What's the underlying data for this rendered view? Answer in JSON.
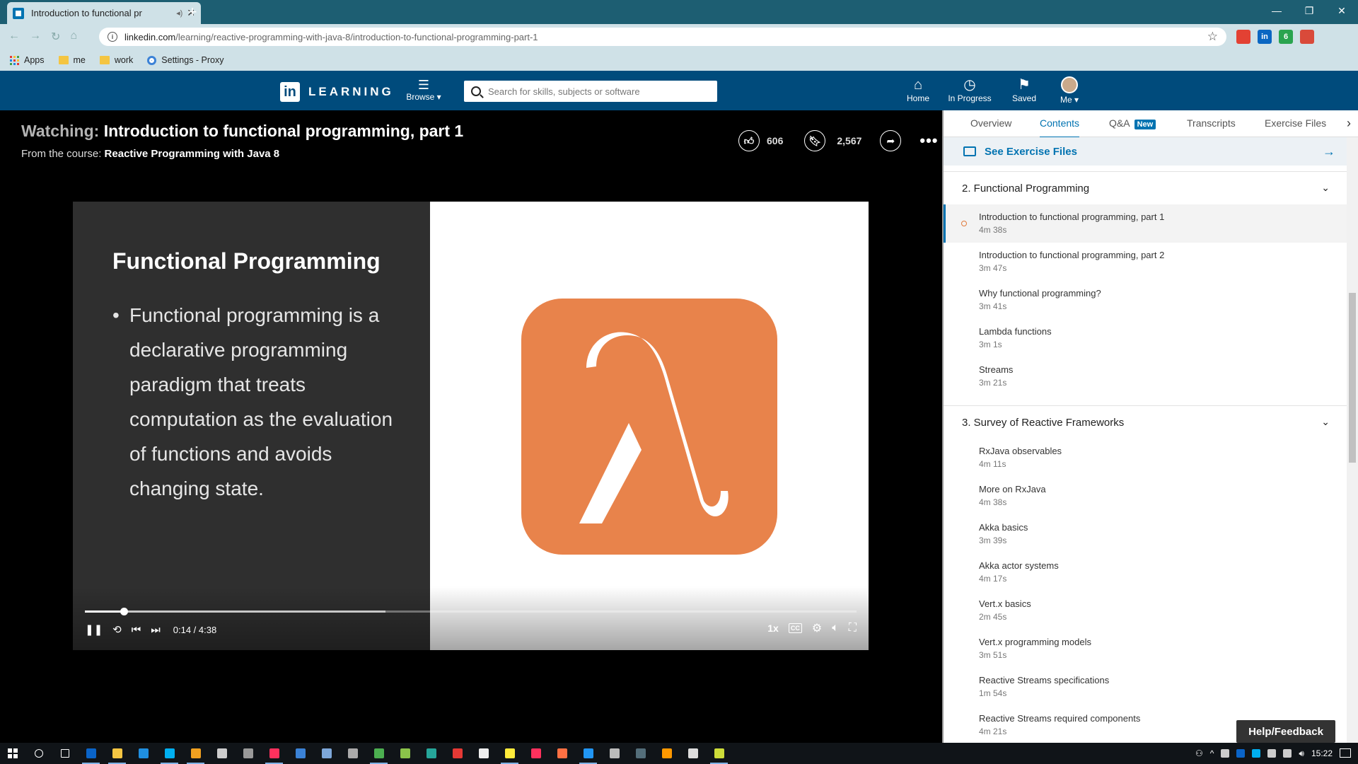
{
  "browser": {
    "tab_title": "Introduction to functional pr",
    "url_host": "linkedin.com",
    "url_path": "/learning/reactive-programming-with-java-8/introduction-to-functional-programming-part-1",
    "bookmarks": [
      "Apps",
      "me",
      "work",
      "Settings - Proxy"
    ],
    "extensions": [
      {
        "name": "google-icon",
        "color": "#e34133"
      },
      {
        "name": "linkedin-icon",
        "label": "in",
        "color": "#0a66c2"
      },
      {
        "name": "extension-badge-icon",
        "label": "6",
        "color": "#2aa44f"
      },
      {
        "name": "profile-avatar-icon",
        "color": "#d94a3a"
      }
    ]
  },
  "header": {
    "logo_in": "in",
    "logo_word": "LEARNING",
    "browse_label": "Browse ▾",
    "search_placeholder": "Search for skills, subjects or software",
    "nav": [
      {
        "label": "Home",
        "icon": "home-icon"
      },
      {
        "label": "In Progress",
        "icon": "clock-icon"
      },
      {
        "label": "Saved",
        "icon": "bookmark-icon"
      },
      {
        "label": "Me ▾",
        "icon": "avatar"
      }
    ]
  },
  "video": {
    "watching_prefix": "Watching:",
    "title": "Introduction to functional programming, part 1",
    "from_prefix": "From the course:",
    "course": "Reactive Programming with Java 8",
    "likes": "606",
    "saves": "2,567",
    "slide_title": "Functional Programming",
    "slide_bullet": "Functional programming is a declarative programming paradigm that treats computation as the evaluation of functions and avoids changing state.",
    "time": "0:14 / 4:38",
    "played_fraction": 0.05,
    "buffered_fraction": 0.39,
    "speed": "1x",
    "cc": "CC",
    "lambda_color": "#e8834b"
  },
  "panel": {
    "tabs": [
      "Overview",
      "Contents",
      "Q&A",
      "Transcripts",
      "Exercise Files"
    ],
    "active_tab": "Contents",
    "new_badge": "New",
    "exercise_files_label": "See Exercise Files",
    "chapters": [
      {
        "title": "2. Functional Programming",
        "items": [
          {
            "title": "Introduction to functional programming, part 1",
            "duration": "4m 38s",
            "active": true
          },
          {
            "title": "Introduction to functional programming, part 2",
            "duration": "3m 47s"
          },
          {
            "title": "Why functional programming?",
            "duration": "3m 41s"
          },
          {
            "title": "Lambda functions",
            "duration": "3m 1s"
          },
          {
            "title": "Streams",
            "duration": "3m 21s"
          }
        ]
      },
      {
        "title": "3. Survey of Reactive Frameworks",
        "items": [
          {
            "title": "RxJava observables",
            "duration": "4m 11s"
          },
          {
            "title": "More on RxJava",
            "duration": "4m 38s"
          },
          {
            "title": "Akka basics",
            "duration": "3m 39s"
          },
          {
            "title": "Akka actor systems",
            "duration": "4m 17s"
          },
          {
            "title": "Vert.x basics",
            "duration": "2m 45s"
          },
          {
            "title": "Vert.x programming models",
            "duration": "3m 51s"
          },
          {
            "title": "Reactive Streams specifications",
            "duration": "1m 54s"
          },
          {
            "title": "Reactive Streams required components",
            "duration": "4m 21s"
          }
        ]
      }
    ],
    "help_label": "Help/Feedback"
  },
  "taskbar": {
    "clock": "15:22",
    "apps": [
      {
        "name": "search-icon",
        "color": "#ffffff"
      },
      {
        "name": "task-view-icon",
        "color": "#ffffff"
      },
      {
        "name": "outlook-icon",
        "color": "#0a64c8",
        "open": true
      },
      {
        "name": "file-explorer-icon",
        "color": "#f4c542",
        "open": true
      },
      {
        "name": "internet-explorer-icon",
        "color": "#1f8fe0"
      },
      {
        "name": "skype-icon",
        "color": "#00aff0",
        "open": true
      },
      {
        "name": "git-icon",
        "color": "#f0a020",
        "open": true
      },
      {
        "name": "terminal-icon",
        "color": "#cccccc"
      },
      {
        "name": "app-icon",
        "color": "#999999"
      },
      {
        "name": "intellij-icon",
        "color": "#fe315d",
        "open": true
      },
      {
        "name": "app-blue-icon",
        "color": "#3b82d6"
      },
      {
        "name": "virtualbox-icon",
        "color": "#7da7d9"
      },
      {
        "name": "app-gray-icon",
        "color": "#aaaaaa"
      },
      {
        "name": "chrome-icon",
        "color": "#4caf50",
        "open": true
      },
      {
        "name": "app-green-icon",
        "color": "#8bc34a"
      },
      {
        "name": "app-teal-icon",
        "color": "#26a69a"
      },
      {
        "name": "screenshot-icon",
        "color": "#e53935"
      },
      {
        "name": "app-white-icon",
        "color": "#eeeeee"
      },
      {
        "name": "sticky-notes-icon",
        "color": "#ffeb3b",
        "open": true
      },
      {
        "name": "intellij-icon-2",
        "color": "#fe315d"
      },
      {
        "name": "app-red-icon",
        "color": "#ff7043"
      },
      {
        "name": "vscode-icon",
        "color": "#2196f3",
        "open": true
      },
      {
        "name": "app-gray-icon-2",
        "color": "#bbbbbb"
      },
      {
        "name": "app-dark-icon",
        "color": "#546e7a"
      },
      {
        "name": "app-orange-icon",
        "color": "#ff9800"
      },
      {
        "name": "app-mono-icon",
        "color": "#dddddd"
      },
      {
        "name": "notepad-icon",
        "color": "#cddc39",
        "open": true
      }
    ]
  }
}
